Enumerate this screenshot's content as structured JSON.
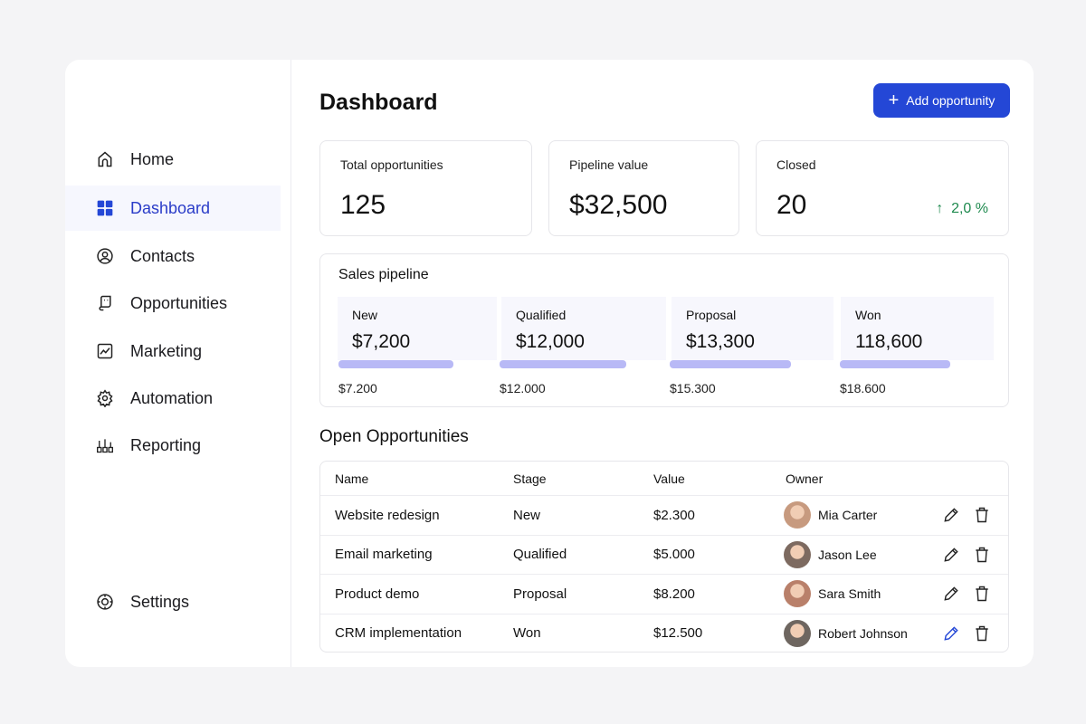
{
  "sidebar": {
    "items": [
      {
        "label": "Home",
        "icon": "home-icon"
      },
      {
        "label": "Dashboard",
        "icon": "dashboard-grid-icon",
        "active": true
      },
      {
        "label": "Contacts",
        "icon": "user-circle-icon"
      },
      {
        "label": "Opportunities",
        "icon": "scroll-icon"
      },
      {
        "label": "Marketing",
        "icon": "chart-line-icon"
      },
      {
        "label": "Automation",
        "icon": "gear-icon"
      },
      {
        "label": "Reporting",
        "icon": "bar-chart-icon"
      }
    ],
    "settings": "Settings"
  },
  "header": {
    "title": "Dashboard",
    "add_button": "Add opportunity"
  },
  "stats": [
    {
      "label": "Total opportunities",
      "value": "125"
    },
    {
      "label": "Pipeline value",
      "value": "$32,500"
    },
    {
      "label": "Closed",
      "value": "20",
      "change": "2,0 %"
    }
  ],
  "pipeline": {
    "title": "Sales pipeline",
    "stages": [
      {
        "name": "New",
        "value": "$7,200",
        "sub": "$7.200",
        "fill": 0.72
      },
      {
        "name": "Qualified",
        "value": "$12,000",
        "sub": "$12.000",
        "fill": 0.77
      },
      {
        "name": "Proposal",
        "value": "$13,300",
        "sub": "$15.300",
        "fill": 0.75
      },
      {
        "name": "Won",
        "value": "118,600",
        "sub": "$18.600",
        "fill": 0.72
      }
    ]
  },
  "opportunities": {
    "title": "Open Opportunities",
    "columns": [
      "Name",
      "Stage",
      "Value",
      "Owner"
    ],
    "rows": [
      {
        "name": "Website redesign",
        "stage": "New",
        "value": "$2.300",
        "owner": "Mia Carter"
      },
      {
        "name": "Email marketing",
        "stage": "Qualified",
        "value": "$5.000",
        "owner": "Jason Lee"
      },
      {
        "name": "Product demo",
        "stage": "Proposal",
        "value": "$8.200",
        "owner": "Sara Smith"
      },
      {
        "name": "CRM implementation",
        "stage": "Won",
        "value": "$12.500",
        "owner": "Robert Johnson"
      }
    ]
  },
  "colors": {
    "accent": "#2447d6",
    "positive": "#1f8a4f",
    "bar": "#b8b9f6"
  }
}
